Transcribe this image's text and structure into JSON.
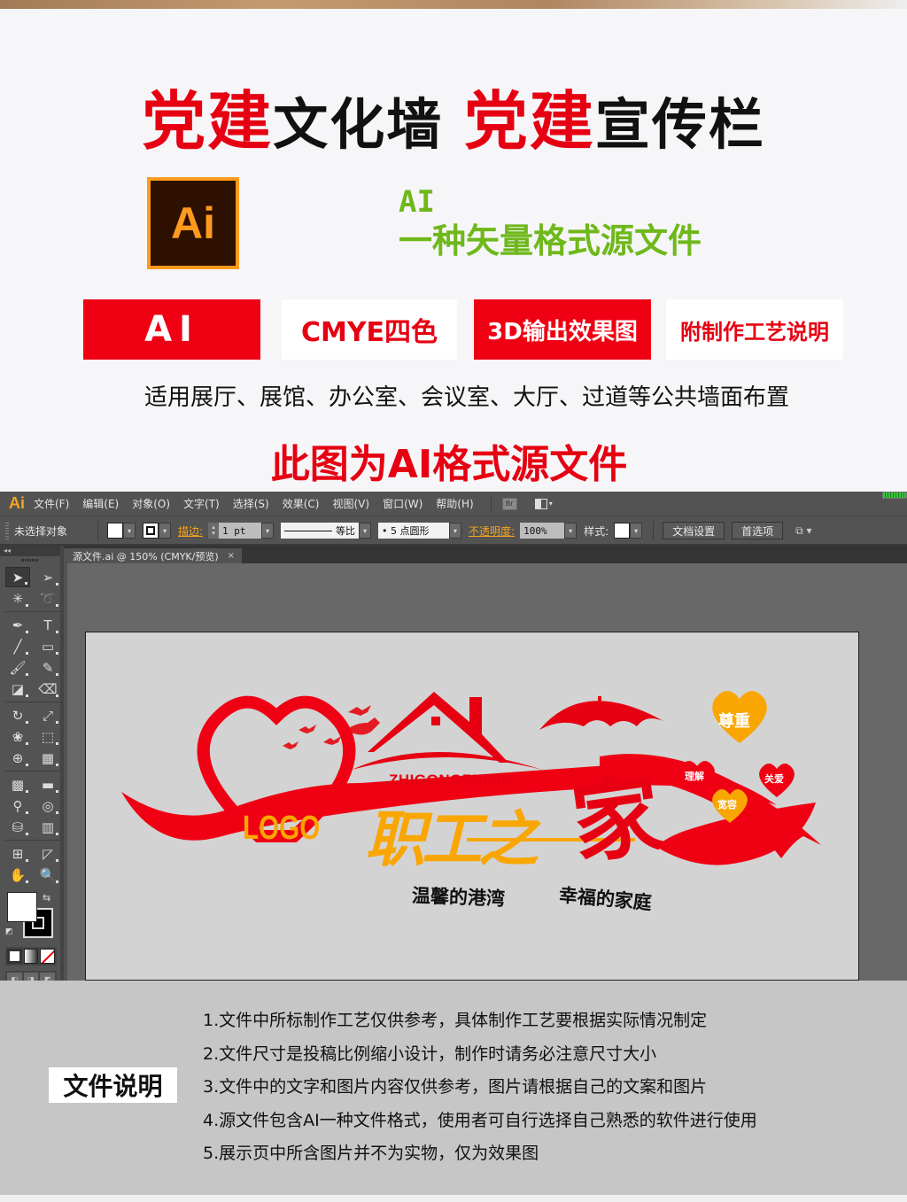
{
  "promo": {
    "headline": [
      {
        "text": "党建",
        "style": "red"
      },
      {
        "text": "文化墙",
        "style": "black"
      },
      {
        "text": "  ",
        "style": "black"
      },
      {
        "text": "党建",
        "style": "red"
      },
      {
        "text": "宣传栏",
        "style": "black"
      }
    ],
    "ai_logo_text": "Ai",
    "format_tag": "AI",
    "format_desc": "一种矢量格式源文件",
    "badges": [
      {
        "label": "AI",
        "style": "red"
      },
      {
        "label": "CMYE四色",
        "style": "white"
      },
      {
        "label": "3D输出效果图",
        "style": "red"
      },
      {
        "label": "附制作工艺说明",
        "style": "white"
      }
    ],
    "venues": "适用展厅、展馆、办公室、会议室、大厅、过道等公共墙面布置",
    "source_note": "此图为AI格式源文件",
    "colors": {
      "red": "#e60012",
      "green": "#6fb81b",
      "ai_orange": "#ff9a1f",
      "ai_dark": "#2e1000"
    }
  },
  "illustrator": {
    "app_icon": "Ai",
    "menu": [
      "文件(F)",
      "编辑(E)",
      "对象(O)",
      "文字(T)",
      "选择(S)",
      "效果(C)",
      "视图(V)",
      "窗口(W)",
      "帮助(H)"
    ],
    "bridge_icon": "Br",
    "control": {
      "selection_status": "未选择对象",
      "stroke_label": "描边:",
      "stroke_weight": "1 pt",
      "stroke_profile": "等比",
      "brush": "• 5 点圆形",
      "opacity_label": "不透明度:",
      "opacity_value": "100%",
      "style_label": "样式:",
      "doc_setup_button": "文档设置",
      "preferences_button": "首选项"
    },
    "document_tab": {
      "title": "源文件.ai @ 150% (CMYK/预览)",
      "close": "×"
    },
    "toolbox_collapse": "◂◂",
    "tools": [
      {
        "name": "selection-tool",
        "glyph": "➤",
        "active": true
      },
      {
        "name": "direct-selection-tool",
        "glyph": "➢"
      },
      {
        "name": "magic-wand-tool",
        "glyph": "✳"
      },
      {
        "name": "lasso-tool",
        "glyph": "➰"
      },
      {
        "name": "sep"
      },
      {
        "name": "pen-tool",
        "glyph": "✒"
      },
      {
        "name": "type-tool",
        "glyph": "T"
      },
      {
        "name": "line-tool",
        "glyph": "╱"
      },
      {
        "name": "rectangle-tool",
        "glyph": "▭"
      },
      {
        "name": "paintbrush-tool",
        "glyph": "🖌"
      },
      {
        "name": "pencil-tool",
        "glyph": "✎"
      },
      {
        "name": "blob-brush-tool",
        "glyph": "◪"
      },
      {
        "name": "eraser-tool",
        "glyph": "⌫"
      },
      {
        "name": "sep"
      },
      {
        "name": "rotate-tool",
        "glyph": "↻"
      },
      {
        "name": "scale-tool",
        "glyph": "⤢"
      },
      {
        "name": "warp-tool",
        "glyph": "❀"
      },
      {
        "name": "free-transform-tool",
        "glyph": "⬚"
      },
      {
        "name": "shape-builder-tool",
        "glyph": "⊕"
      },
      {
        "name": "perspective-grid-tool",
        "glyph": "▦"
      },
      {
        "name": "sep"
      },
      {
        "name": "mesh-tool",
        "glyph": "▩"
      },
      {
        "name": "gradient-tool",
        "glyph": "▬"
      },
      {
        "name": "eyedropper-tool",
        "glyph": "⚲"
      },
      {
        "name": "blend-tool",
        "glyph": "◎"
      },
      {
        "name": "symbol-sprayer-tool",
        "glyph": "⛁"
      },
      {
        "name": "column-graph-tool",
        "glyph": "▥"
      },
      {
        "name": "sep"
      },
      {
        "name": "artboard-tool",
        "glyph": "⊞"
      },
      {
        "name": "slice-tool",
        "glyph": "◸"
      },
      {
        "name": "hand-tool",
        "glyph": "✋"
      },
      {
        "name": "zoom-tool",
        "glyph": "🔍"
      }
    ],
    "swap_glyph": "⇆",
    "default_glyph": "◩",
    "draw_modes": [
      "◧",
      "◨",
      "◩"
    ]
  },
  "artwork": {
    "pinyin": "ZHIGONGZHIJIA",
    "title": "职工之",
    "jia": "家",
    "logo": "LOGO",
    "slogan_left": "温馨的港湾",
    "slogan_right": "幸福的家庭",
    "hearts": [
      {
        "label": "尊重",
        "color": "#f9a602"
      },
      {
        "label": "理解",
        "color": "#e60012"
      },
      {
        "label": "关爱",
        "color": "#e60012"
      },
      {
        "label": "宽容",
        "color": "#f9a602"
      }
    ],
    "colors": {
      "red": "#e60012",
      "orange": "#f9a602"
    }
  },
  "notes": {
    "title": "文件说明",
    "items": [
      "1.文件中所标制作工艺仅供参考，具体制作工艺要根据实际情况制定",
      "2.文件尺寸是投稿比例缩小设计，制作时请务必注意尺寸大小",
      "3.文件中的文字和图片内容仅供参考，图片请根据自己的文案和图片",
      "4.源文件包含AI一种文件格式，使用者可自行选择自己熟悉的软件进行使用",
      "5.展示页中所含图片并不为实物，仅为效果图"
    ]
  }
}
